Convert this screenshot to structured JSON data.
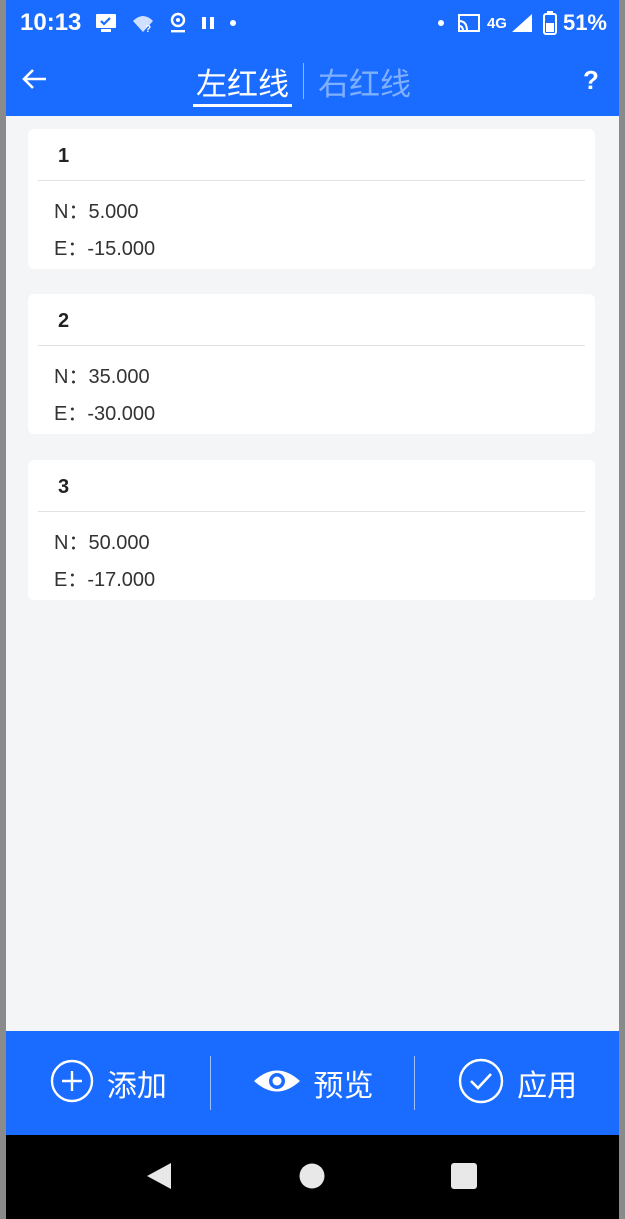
{
  "status_bar": {
    "time": "10:13",
    "network": "4G",
    "battery": "51%"
  },
  "app_bar": {
    "tabs": [
      {
        "label": "左红线",
        "active": true
      },
      {
        "label": "右红线",
        "active": false
      }
    ],
    "help_label": "?"
  },
  "points": [
    {
      "index": "1",
      "n": "N：5.000",
      "e": "E：-15.000"
    },
    {
      "index": "2",
      "n": "N：35.000",
      "e": "E：-30.000"
    },
    {
      "index": "3",
      "n": "N：50.000",
      "e": "E：-17.000"
    }
  ],
  "actions": {
    "add_label": "添加",
    "preview_label": "预览",
    "apply_label": "应用"
  },
  "colors": {
    "primary": "#1a6bff",
    "background": "#f3f5f6",
    "card": "#ffffff"
  },
  "icons": {
    "back": "arrow-left-icon",
    "add": "plus-circle-icon",
    "preview": "eye-icon",
    "apply": "check-circle-icon"
  }
}
